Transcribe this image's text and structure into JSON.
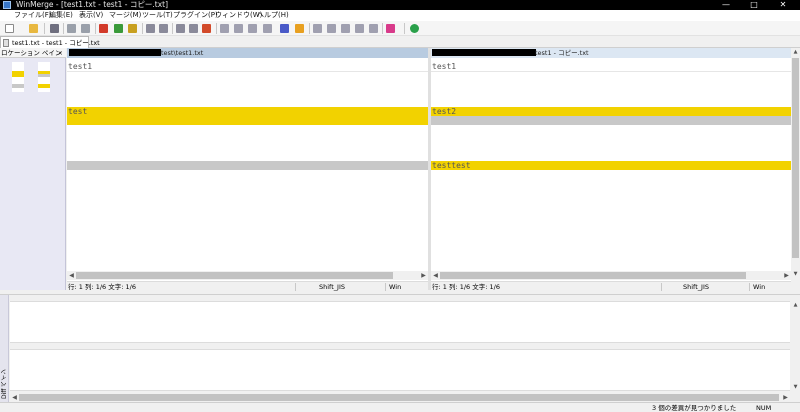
{
  "window": {
    "title": "WinMerge - [test1.txt - test1 - コピー.txt]",
    "minimize_glyph": "—",
    "maximize_glyph": "□",
    "close_glyph": "✕"
  },
  "menu": [
    "ファイル(F)",
    "編集(E)",
    "表示(V)",
    "マージ(M)",
    "ツール(T)",
    "プラグイン(P)",
    "ウィンドウ(W)",
    "ヘルプ(H)"
  ],
  "toolbar": {
    "icons": [
      "new-icon",
      "open-icon",
      "save-icon",
      "undo-icon",
      "redo-icon",
      "merge-icon",
      "merge-all-icon",
      "prev-diff-icon",
      "next-diff-icon",
      "first-diff-icon",
      "current-diff-icon",
      "last-diff-icon",
      "copy-right-icon",
      "copy-left-icon",
      "copy-right-advance-icon",
      "copy-left-advance-icon",
      "all-right-icon",
      "all-left-icon",
      "compare-icon",
      "options-icon",
      "refresh-icon"
    ]
  },
  "tab": {
    "label": "test1.txt - test1 - コピー.txt"
  },
  "location_pane": {
    "title": "ロケーション ペイン",
    "close_glyph": "×"
  },
  "left": {
    "path_suffix": "test\\test1.txt",
    "lines": [
      "test1",
      "",
      "",
      "",
      "",
      "test",
      "",
      "",
      "",
      "",
      "",
      ""
    ],
    "status": {
      "position": "行: 1  列: 1/6  文字: 1/6",
      "encoding": "Shift_JIS",
      "eol": "Win"
    }
  },
  "right": {
    "path_suffix": "test1 - コピー.txt",
    "lines": [
      "test1",
      "",
      "",
      "",
      "",
      "test2",
      "",
      "",
      "",
      "",
      "",
      "testtest"
    ],
    "status": {
      "position": "行: 1  列: 1/6  文字: 1/6",
      "encoding": "Shift_JIS",
      "eol": "Win"
    }
  },
  "diff_pane": {
    "title": "Diff ペイン"
  },
  "statusbar": {
    "message": "3 個の差異が見つかりました",
    "mode": "NUM"
  },
  "colors": {
    "diff_yellow": "#f2d200",
    "missing_gray": "#c8c8c8",
    "left_header": "#b8cbe0",
    "right_header": "#dce7f3"
  }
}
